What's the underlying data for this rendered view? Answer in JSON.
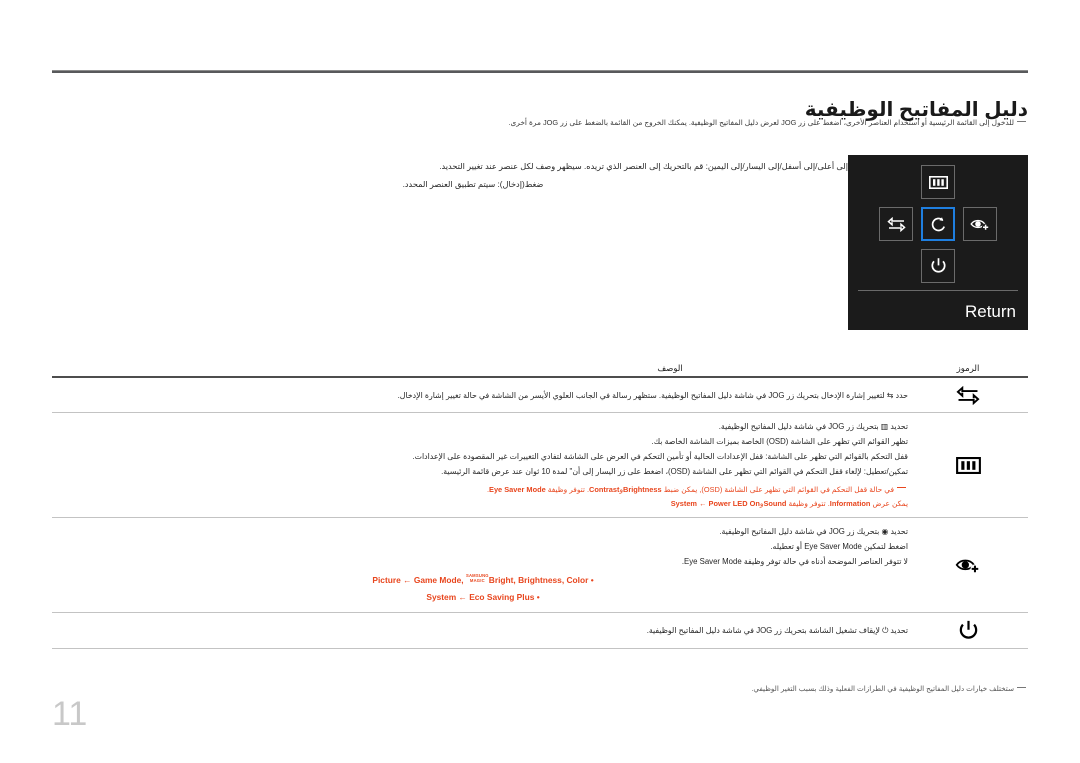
{
  "page": {
    "number": "11",
    "title": "دليل المفاتيح الوظيفية",
    "intro_note": "للدخول إلى القائمة الرئيسية أو استخدام العناصر الأخرى، اضغط على زر JOG لعرض دليل المفاتيح الوظيفية. يمكنك الخروج من القائمة بالضغط على زر JOG مرة أخرى."
  },
  "diagram": {
    "instruction_line_1": "إلى أعلى/إلى أسفل/إلى اليسار/إلى اليمين: قم بالتحريك إلى العنصر الذي تريده. سيظهر وصف لكل عنصر عند تغيير التحديد.",
    "instruction_line_2": "ضغط(إدخال): سيتم تطبيق العنصر المحدد.",
    "return_label": "Return",
    "keys": [
      {
        "name": "menu-key",
        "icon": "menu-bars-icon",
        "position": "top"
      },
      {
        "name": "source-key",
        "icon": "source-swap-icon",
        "position": "left"
      },
      {
        "name": "return-key",
        "icon": "return-arrow-icon",
        "position": "center",
        "selected": true
      },
      {
        "name": "eye-saver-key",
        "icon": "eye-saver-icon",
        "position": "right"
      },
      {
        "name": "power-key",
        "icon": "power-icon",
        "position": "bottom"
      }
    ],
    "highlight_color": "#1f7fe0",
    "panel_color": "#1b1b1b"
  },
  "table": {
    "header": {
      "symbols": "الرموز",
      "description": "الوصف"
    },
    "rows": [
      {
        "icon": "source-swap-icon",
        "lines": [
          {
            "text": "حدد ⇆ لتغيير إشارة الإدخال بتحريك زر JOG في شاشة دليل المفاتيح الوظيفية. ستظهر رسالة في الجانب العلوي الأيسر من الشاشة في حالة تغيير إشارة الإدخال.",
            "align": "right"
          }
        ]
      },
      {
        "icon": "menu-bars-icon",
        "lines": [
          {
            "text": "تحديد ▥ بتحريك زر JOG في شاشة دليل المفاتيح الوظيفية.",
            "align": "right"
          },
          {
            "text": "تظهر القوائم التي تظهر على الشاشة (OSD) الخاصة بميزات الشاشة الخاصة بك.",
            "align": "right"
          },
          {
            "text": "قفل التحكم بالقوائم التي تظهر على الشاشة: قفل الإعدادات الحالية أو تأمين التحكم في العرض على الشاشة لتفادي التغييرات غير المقصودة على الإعدادات.",
            "align": "right"
          },
          {
            "text": "تمكين/تعطيل: لإلغاء قفل التحكم في القوائم التي تظهر على الشاشة (OSD)، اضغط على زر اليسار إلى أن\" لمدة 10 ثوان عند عرض قائمة الرئيسية.",
            "align": "right"
          }
        ],
        "note": {
          "line1_pre": "في حالة قفل التحكم في القوائم التي تظهر على الشاشة (OSD), يمكن ضبط",
          "line1_bold1": "Brightness",
          "line1_mid": "و",
          "line1_bold2": "Contrast",
          "line1_post": ". تتوفر وظيفة",
          "line1_bold3": "Eye Saver Mode",
          "line1_end": ".",
          "line2_pre": "يمكن عرض",
          "line2_bold1": "Information",
          "line2_mid": ". تتوفر وظيفة",
          "line2_bold2": "Sound",
          "line2_and": "و",
          "line2_bold3": "Power LED On",
          "line2_arrow": "←",
          "line2_bold4": "System",
          "color": "#e8461e"
        }
      },
      {
        "icon": "eye-saver-icon",
        "lines": [
          {
            "text": "تحديد ◉ بتحريك زر JOG في شاشة دليل المفاتيح الوظيفية.",
            "align": "right"
          },
          {
            "text": "اضغط لتمكين Eye Saver Mode أو تعطيله.",
            "align": "right"
          },
          {
            "text": "لا تتوفر العناصر الموضحة أدناه في حالة توفر وظيفة Eye Saver Mode.",
            "align": "right"
          }
        ],
        "bullets": [
          {
            "dot": "•",
            "prefix": "Picture",
            "arrow": "←",
            "items": [
              "Game Mode",
              "Bright",
              "Brightness",
              "Color"
            ],
            "magic_logo_top": "SAMSUNG",
            "magic_logo_bottom": "MAGIC"
          },
          {
            "dot": "•",
            "prefix": "System",
            "arrow": "←",
            "items": [
              "Eco Saving Plus"
            ]
          }
        ]
      },
      {
        "icon": "power-icon",
        "lines": [
          {
            "text": "تحديد ⏻ لإيقاف تشغيل الشاشة بتحريك زر JOG في شاشة دليل المفاتيح الوظيفية.",
            "align": "right"
          }
        ]
      }
    ]
  },
  "footer": {
    "note": "ستختلف خيارات دليل المفاتيح الوظيفية في الطرازات الفعلية وذلك بسبب التغير الوظيفي."
  }
}
